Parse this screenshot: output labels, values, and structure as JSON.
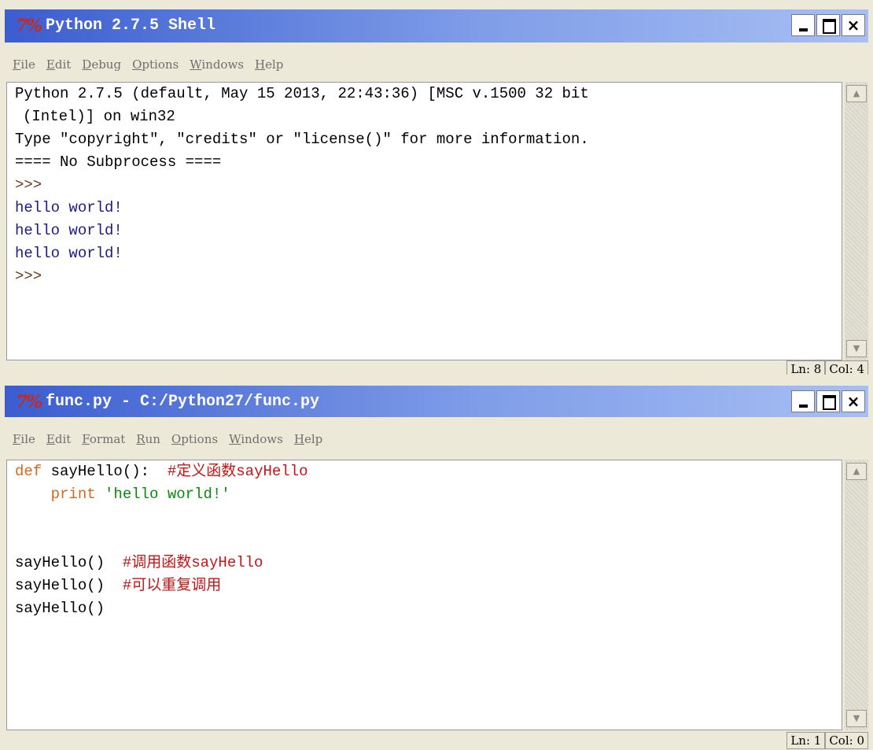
{
  "shell": {
    "title": "Python 2.7.5 Shell",
    "logo": "7%",
    "menu": [
      "File",
      "Edit",
      "Debug",
      "Options",
      "Windows",
      "Help"
    ],
    "lines": [
      {
        "text": "Python 2.7.5 (default, May 15 2013, 22:43:36) [MSC v.1500 32 bit",
        "kind": "plain"
      },
      {
        "text": "(Intel)] on win32",
        "kind": "plain"
      },
      {
        "text": "Type \"copyright\", \"credits\" or \"license()\" for more information.",
        "kind": "plain"
      },
      {
        "text": "==== No Subprocess ====",
        "kind": "plain"
      },
      {
        "text": ">>>",
        "kind": "prompt"
      },
      {
        "text": "hello world!",
        "kind": "output"
      },
      {
        "text": "hello world!",
        "kind": "output"
      },
      {
        "text": "hello world!",
        "kind": "output"
      },
      {
        "text": ">>>",
        "kind": "prompt"
      }
    ],
    "status": {
      "ln": "Ln: 8",
      "col": "Col: 4"
    }
  },
  "editor": {
    "title": "func.py - C:/Python27/func.py",
    "logo": "7%",
    "menu": [
      "File",
      "Edit",
      "Format",
      "Run",
      "Options",
      "Windows",
      "Help"
    ],
    "code": {
      "line1_kw": "def",
      "line1_rest": " sayHello():  ",
      "line1_comment": "#定义函数sayHello",
      "line2_indent": "    print ",
      "line2_str": "'hello world!'",
      "line5_code": "sayHello()  ",
      "line5_comment": "#调用函数sayHello",
      "line6_code": "sayHello()  ",
      "line6_comment": "#可以重复调用",
      "line7_code": "sayHello()"
    },
    "status": {
      "ln": "Ln: 1",
      "col": "Col: 0"
    }
  },
  "colors": {
    "title_gradient_start": "#3b5dcf",
    "keyword": "#d2691e",
    "string": "#0a8a0a",
    "comment": "#c81414",
    "output": "#1b1b8a"
  }
}
